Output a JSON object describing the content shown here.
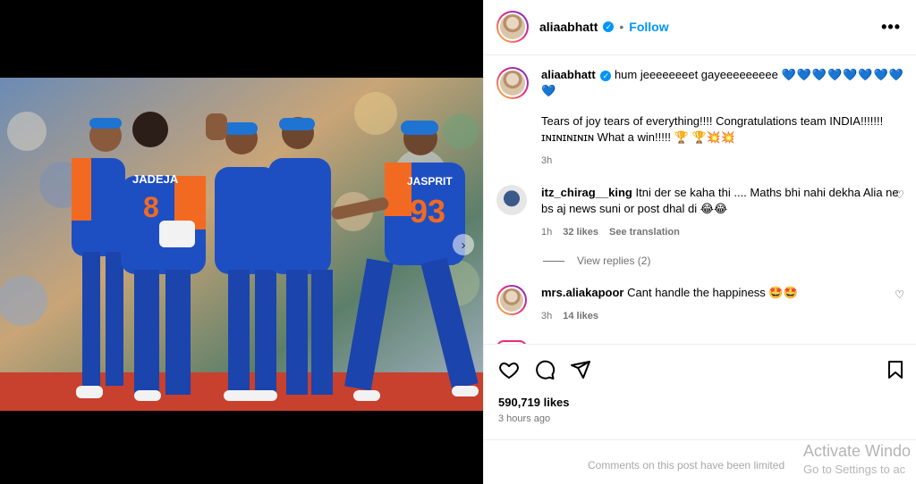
{
  "post": {
    "username": "aliaabhatt",
    "verified_icon": "verified-badge-icon",
    "separator": "•",
    "follow_label": "Follow",
    "more_icon": "more-options-icon",
    "more_glyph": "•••"
  },
  "caption": {
    "username": "aliaabhatt",
    "line1": "hum jeeeeeeeet gayeeeeeeeee",
    "hearts": "💙💙💙💙💙💙💙💙💙",
    "line2": "Tears of joy tears of everything!!!! Congratulations team INDIA!!!!!!! ɪɴɪɴɪɴɪɴɪɴ What a win!!!!! 🏆 🏆💥💥",
    "time": "3h"
  },
  "comments": [
    {
      "username": "itz_chirag__king",
      "text": "Itni der se kaha thi .... Maths bhi nahi dekha Alia ne bs aj news suni or post dhal di 😂😂",
      "time": "1h",
      "likes": "32 likes",
      "translate": "See translation"
    },
    {
      "username": "mrs.aliakapoor",
      "text": "Cant handle the happiness 🤩🤩",
      "time": "3h",
      "likes": "14 likes"
    }
  ],
  "view_replies": "View replies (2)",
  "actions": {
    "like_icon": "heart-icon",
    "comment_icon": "comment-icon",
    "share_icon": "share-icon",
    "save_icon": "bookmark-icon"
  },
  "likes_count": "590,719 likes",
  "post_time": "3 hours ago",
  "comments_limited": "Comments on this post have been limited",
  "watermark": {
    "line1": "Activate Windo",
    "line2": "Go to Settings to ac"
  },
  "carousel_next_glyph": "›",
  "colors": {
    "accent": "#0095f6",
    "jersey_blue": "#1e4fc2",
    "jersey_orange": "#f26a21"
  }
}
